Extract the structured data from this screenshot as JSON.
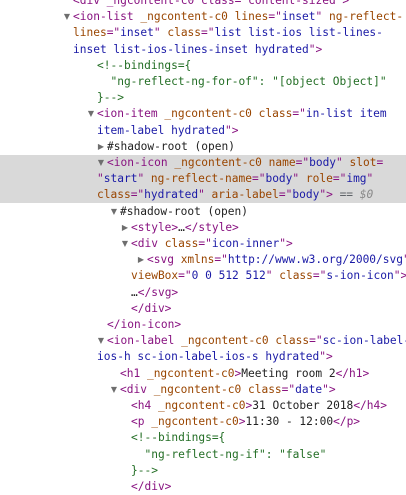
{
  "lines": [
    {
      "indent": 73,
      "arrow": "",
      "cut": true,
      "spans": [
        {
          "c": "t",
          "s": "<div _ngcontent-c0 class=\"content-sized\">"
        }
      ]
    },
    {
      "indent": 73,
      "arrow": "down",
      "spans": [
        {
          "c": "t",
          "s": "<ion-list "
        },
        {
          "c": "a",
          "s": "_ngcontent-c0 lines"
        },
        {
          "c": "t",
          "s": "=\""
        },
        {
          "c": "v",
          "s": "inset"
        },
        {
          "c": "t",
          "s": "\" "
        },
        {
          "c": "a",
          "s": "ng-reflect-"
        }
      ]
    },
    {
      "indent": 73,
      "arrow": "",
      "spans": [
        {
          "c": "a",
          "s": "lines"
        },
        {
          "c": "t",
          "s": "=\""
        },
        {
          "c": "v",
          "s": "inset"
        },
        {
          "c": "t",
          "s": "\" "
        },
        {
          "c": "a",
          "s": "class"
        },
        {
          "c": "t",
          "s": "=\""
        },
        {
          "c": "v",
          "s": "list list-ios list-lines-"
        }
      ]
    },
    {
      "indent": 73,
      "arrow": "",
      "spans": [
        {
          "c": "v",
          "s": "inset list-ios-lines-inset hydrated"
        },
        {
          "c": "t",
          "s": "\">"
        }
      ]
    },
    {
      "indent": 97,
      "arrow": "",
      "spans": [
        {
          "c": "c",
          "s": "<!--bindings={"
        }
      ]
    },
    {
      "indent": 97,
      "arrow": "",
      "spans": [
        {
          "c": "c",
          "s": "  \"ng-reflect-ng-for-of\": \"[object Object]\""
        }
      ]
    },
    {
      "indent": 97,
      "arrow": "",
      "spans": [
        {
          "c": "c",
          "s": "}-->"
        }
      ]
    },
    {
      "indent": 97,
      "arrow": "down",
      "spans": [
        {
          "c": "t",
          "s": "<ion-item "
        },
        {
          "c": "a",
          "s": "_ngcontent-c0 class"
        },
        {
          "c": "t",
          "s": "=\""
        },
        {
          "c": "v",
          "s": "in-list item"
        }
      ]
    },
    {
      "indent": 97,
      "arrow": "",
      "spans": [
        {
          "c": "v",
          "s": "item-label hydrated"
        },
        {
          "c": "t",
          "s": "\">"
        }
      ]
    },
    {
      "indent": 107,
      "arrow": "right",
      "spans": [
        {
          "c": "x",
          "s": "#shadow-root (open)"
        }
      ]
    },
    {
      "indent": 107,
      "arrow": "down",
      "sel": true,
      "spans": [
        {
          "c": "t",
          "s": "<ion-icon "
        },
        {
          "c": "a",
          "s": "_ngcontent-c0 name"
        },
        {
          "c": "t",
          "s": "=\""
        },
        {
          "c": "v",
          "s": "body"
        },
        {
          "c": "t",
          "s": "\" "
        },
        {
          "c": "a",
          "s": "slot"
        },
        {
          "c": "t",
          "s": "="
        }
      ]
    },
    {
      "indent": 97,
      "arrow": "",
      "sel": true,
      "spans": [
        {
          "c": "t",
          "s": "\""
        },
        {
          "c": "v",
          "s": "start"
        },
        {
          "c": "t",
          "s": "\" "
        },
        {
          "c": "a",
          "s": "ng-reflect-name"
        },
        {
          "c": "t",
          "s": "=\""
        },
        {
          "c": "v",
          "s": "body"
        },
        {
          "c": "t",
          "s": "\" "
        },
        {
          "c": "a",
          "s": "role"
        },
        {
          "c": "t",
          "s": "=\""
        },
        {
          "c": "v",
          "s": "img"
        },
        {
          "c": "t",
          "s": "\""
        }
      ]
    },
    {
      "indent": 97,
      "arrow": "",
      "sel": true,
      "spans": [
        {
          "c": "a",
          "s": "class"
        },
        {
          "c": "t",
          "s": "=\""
        },
        {
          "c": "v",
          "s": "hydrated"
        },
        {
          "c": "t",
          "s": "\" "
        },
        {
          "c": "a",
          "s": "aria-label"
        },
        {
          "c": "t",
          "s": "=\""
        },
        {
          "c": "v",
          "s": "body"
        },
        {
          "c": "t",
          "s": "\">"
        },
        {
          "c": "g",
          "s": " == "
        },
        {
          "c": "m",
          "s": "$0"
        }
      ]
    },
    {
      "indent": 120,
      "arrow": "down",
      "spans": [
        {
          "c": "x",
          "s": "#shadow-root (open)"
        }
      ]
    },
    {
      "indent": 131,
      "arrow": "right",
      "spans": [
        {
          "c": "t",
          "s": "<style>"
        },
        {
          "c": "x",
          "s": "…"
        },
        {
          "c": "t",
          "s": "</style>"
        }
      ]
    },
    {
      "indent": 131,
      "arrow": "down",
      "spans": [
        {
          "c": "t",
          "s": "<div "
        },
        {
          "c": "a",
          "s": "class"
        },
        {
          "c": "t",
          "s": "=\""
        },
        {
          "c": "v",
          "s": "icon-inner"
        },
        {
          "c": "t",
          "s": "\">"
        }
      ]
    },
    {
      "indent": 147,
      "arrow": "right",
      "spans": [
        {
          "c": "t",
          "s": "<svg "
        },
        {
          "c": "a",
          "s": "xmlns"
        },
        {
          "c": "t",
          "s": "=\""
        },
        {
          "c": "v",
          "s": "http://www.w3.org/2000/svg"
        },
        {
          "c": "t",
          "s": "\""
        }
      ]
    },
    {
      "indent": 131,
      "arrow": "",
      "spans": [
        {
          "c": "a",
          "s": "viewBox"
        },
        {
          "c": "t",
          "s": "=\""
        },
        {
          "c": "v",
          "s": "0 0 512 512"
        },
        {
          "c": "t",
          "s": "\" "
        },
        {
          "c": "a",
          "s": "class"
        },
        {
          "c": "t",
          "s": "=\""
        },
        {
          "c": "v",
          "s": "s-ion-icon"
        },
        {
          "c": "t",
          "s": "\">"
        }
      ]
    },
    {
      "indent": 131,
      "arrow": "",
      "spans": [
        {
          "c": "x",
          "s": "…"
        },
        {
          "c": "t",
          "s": "</svg>"
        }
      ]
    },
    {
      "indent": 131,
      "arrow": "",
      "spans": [
        {
          "c": "t",
          "s": "</div>"
        }
      ]
    },
    {
      "indent": 107,
      "arrow": "",
      "spans": [
        {
          "c": "t",
          "s": "</ion-icon>"
        }
      ]
    },
    {
      "indent": 107,
      "arrow": "down",
      "spans": [
        {
          "c": "t",
          "s": "<ion-label "
        },
        {
          "c": "a",
          "s": "_ngcontent-c0 class"
        },
        {
          "c": "t",
          "s": "=\""
        },
        {
          "c": "v",
          "s": "sc-ion-label-"
        }
      ]
    },
    {
      "indent": 97,
      "arrow": "",
      "spans": [
        {
          "c": "v",
          "s": "ios-h sc-ion-label-ios-s hydrated"
        },
        {
          "c": "t",
          "s": "\">"
        }
      ]
    },
    {
      "indent": 120,
      "arrow": "",
      "spans": [
        {
          "c": "t",
          "s": "<h1 "
        },
        {
          "c": "a",
          "s": "_ngcontent-c0"
        },
        {
          "c": "t",
          "s": ">"
        },
        {
          "c": "x",
          "s": "Meeting room 2"
        },
        {
          "c": "t",
          "s": "</h1>"
        }
      ]
    },
    {
      "indent": 120,
      "arrow": "down",
      "spans": [
        {
          "c": "t",
          "s": "<div "
        },
        {
          "c": "a",
          "s": "_ngcontent-c0 class"
        },
        {
          "c": "t",
          "s": "=\""
        },
        {
          "c": "v",
          "s": "date"
        },
        {
          "c": "t",
          "s": "\">"
        }
      ]
    },
    {
      "indent": 131,
      "arrow": "",
      "spans": [
        {
          "c": "t",
          "s": "<h4 "
        },
        {
          "c": "a",
          "s": "_ngcontent-c0"
        },
        {
          "c": "t",
          "s": ">"
        },
        {
          "c": "x",
          "s": "31 October 2018"
        },
        {
          "c": "t",
          "s": "</h4>"
        }
      ]
    },
    {
      "indent": 131,
      "arrow": "",
      "spans": [
        {
          "c": "t",
          "s": "<p "
        },
        {
          "c": "a",
          "s": "_ngcontent-c0"
        },
        {
          "c": "t",
          "s": ">"
        },
        {
          "c": "x",
          "s": "11:30 - 12:00"
        },
        {
          "c": "t",
          "s": "</p>"
        }
      ]
    },
    {
      "indent": 131,
      "arrow": "",
      "spans": [
        {
          "c": "c",
          "s": "<!--bindings={"
        }
      ]
    },
    {
      "indent": 131,
      "arrow": "",
      "spans": [
        {
          "c": "c",
          "s": "  \"ng-reflect-ng-if\": \"false\""
        }
      ]
    },
    {
      "indent": 131,
      "arrow": "",
      "spans": [
        {
          "c": "c",
          "s": "}-->"
        }
      ]
    },
    {
      "indent": 131,
      "arrow": "",
      "cut": true,
      "spans": [
        {
          "c": "t",
          "s": "</div>"
        }
      ]
    }
  ]
}
